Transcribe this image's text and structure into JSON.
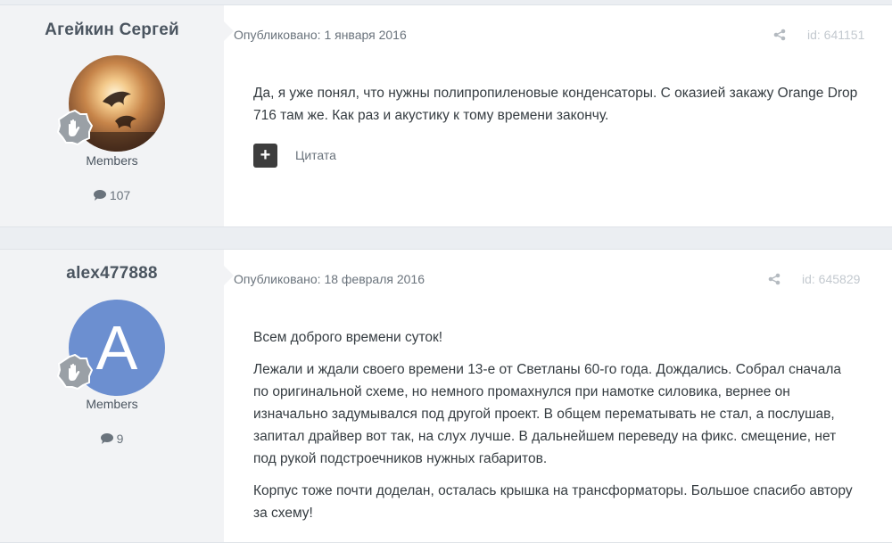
{
  "posts": [
    {
      "author": "Агейкин Сергей",
      "role": "Members",
      "post_count": "107",
      "published": "Опубликовано: 1 января 2016",
      "post_id": "id: 641151",
      "paragraphs": [
        "Да, я уже понял, что нужны полипропиленовые конденсаторы. С оказией закажу Orange Drop 716 там же. Как раз и акустику к тому времени закончу."
      ],
      "quote_label": "Цитата"
    },
    {
      "author": "alex477888",
      "avatar_letter": "A",
      "role": "Members",
      "post_count": "9",
      "published": "Опубликовано: 18 февраля 2016",
      "post_id": "id: 645829",
      "paragraphs": [
        "Всем доброго времени суток!",
        "Лежали и ждали своего времени 13-е от Светланы 60-го года. Дождались. Собрал сначала по оригинальной схеме, но немного промахнулся при намотке силовика, вернее он изначально задумывался под другой проект. В общем перематывать не стал, а послушав, запитал драйвер вот так, на слух лучше. В дальнейшем переведу на фикс. смещение, нет под рукой подстроечников нужных габаритов.",
        "Корпус тоже почти доделан, осталась крышка на трансформаторы. Большое спасибо автору за схему!"
      ]
    }
  ],
  "colors": {
    "avatar_letter_bg": "#6c8fd0",
    "page_bg": "#ebeef2",
    "author_panel_bg": "#f2f3f5"
  },
  "icons": [
    "share-icon",
    "comment-icon",
    "rank-badge-icon",
    "plus-icon"
  ]
}
